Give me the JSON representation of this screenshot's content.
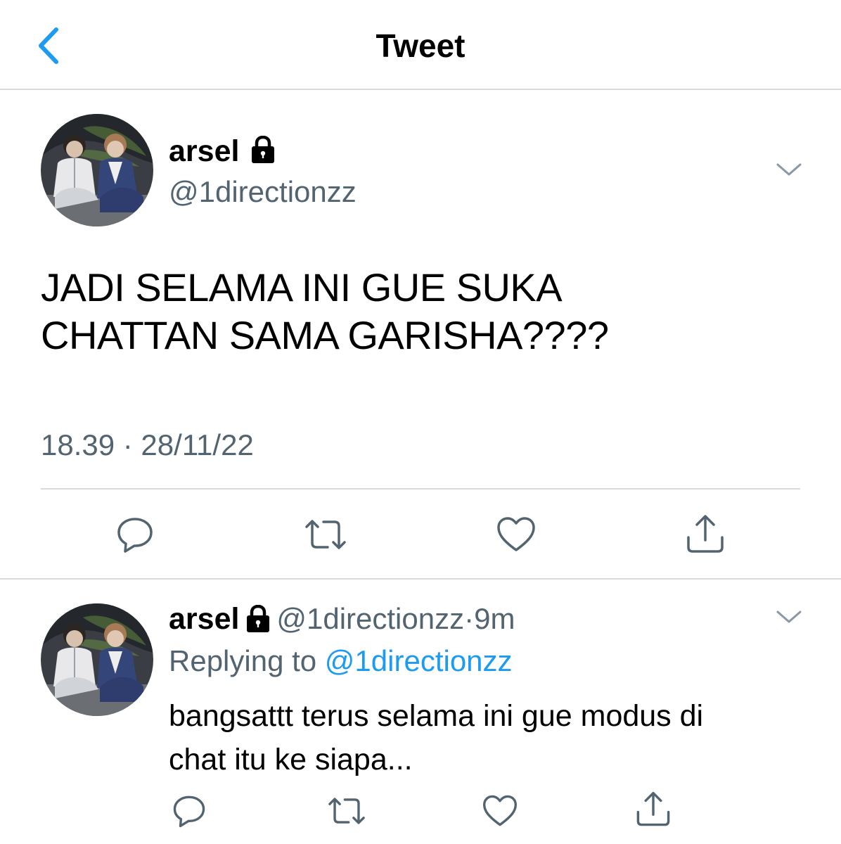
{
  "header": {
    "title": "Tweet",
    "back_icon": "chevron-left-icon",
    "accent": "#1d9bf0"
  },
  "main_tweet": {
    "author": {
      "name": "arsel",
      "handle": "@1directionzz",
      "protected_icon": "lock-icon"
    },
    "text_line1": "JADI SELAMA INI GUE SUKA",
    "text_line2": "CHATTAN SAMA GARISHA????",
    "timestamp": "18.39 · 28/11/22",
    "actions": [
      "reply-icon",
      "retweet-icon",
      "like-icon",
      "share-icon"
    ]
  },
  "reply_tweet": {
    "author": {
      "name": "arsel",
      "handle": "@1directionzz",
      "time": "9m",
      "separator": "·"
    },
    "replying_prefix": "Replying to",
    "replying_to": "@1directionzz",
    "text_line1": "bangsattt terus selama ini gue modus di",
    "text_line2": "chat itu ke siapa...",
    "actions": [
      "reply-icon",
      "retweet-icon",
      "like-icon",
      "share-icon"
    ]
  },
  "colors": {
    "text": "#000000",
    "secondary": "#536471",
    "divider": "#d9d9d9",
    "link": "#1d9bf0"
  }
}
